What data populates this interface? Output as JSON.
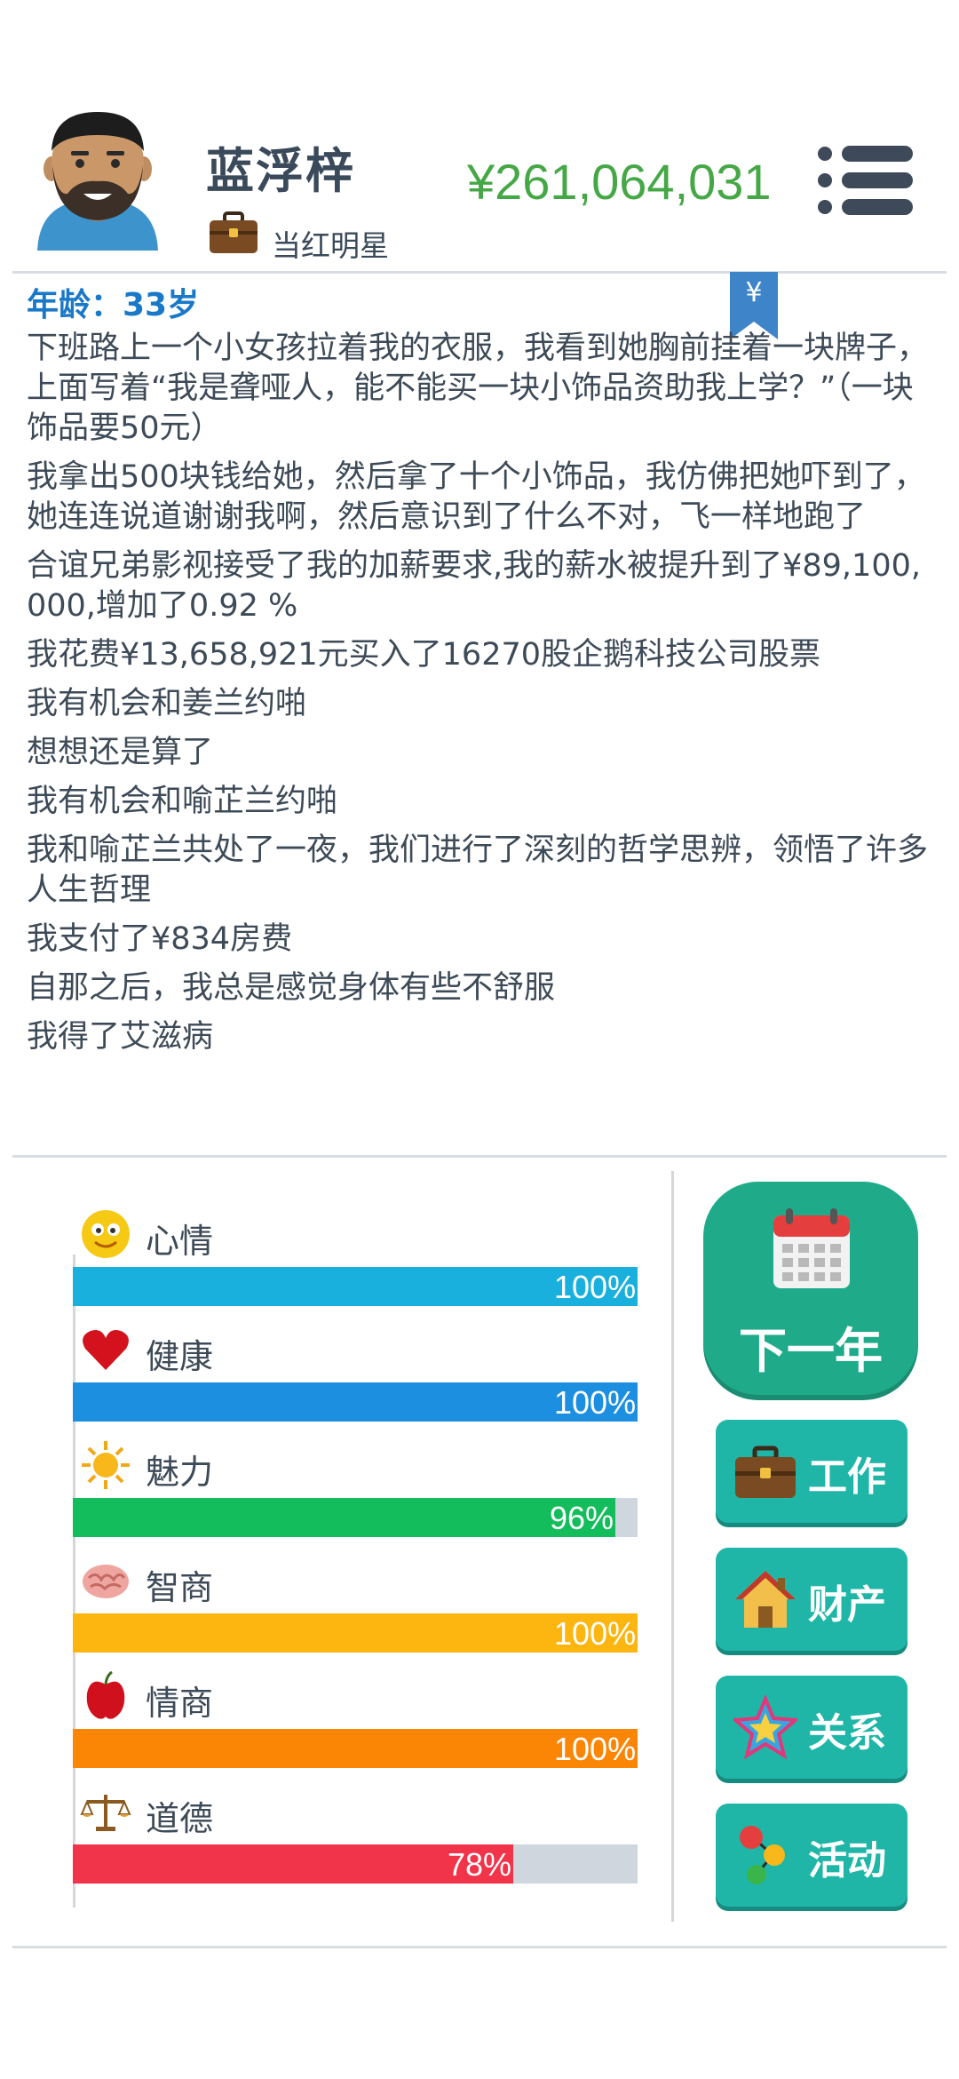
{
  "header": {
    "name": "蓝浮梓",
    "job": "当红明星",
    "money": "¥261,064,031",
    "icons": {
      "avatar": "bearded-man-avatar",
      "job": "briefcase-icon",
      "menu": "menu-icon"
    }
  },
  "age_label": "年龄：33岁",
  "bookmark_label": "¥",
  "log": [
    "下班路上一个小女孩拉着我的衣服，我看到她胸前挂着一块牌子，上面写着“我是聋哑人，能不能买一块小饰品资助我上学？”（一块饰品要50元）",
    "我拿出500块钱给她，然后拿了十个小饰品，我仿佛把她吓到了，她连连说道谢谢我啊，然后意识到了什么不对，飞一样地跑了",
    "合谊兄弟影视接受了我的加薪要求,我的薪水被提升到了¥89,100,000,增加了0.92 %",
    "我花费¥13,658,921元买入了16270股企鹅科技公司股票",
    "我有机会和姜兰约啪",
    "想想还是算了",
    "我有机会和喻芷兰约啪",
    "我和喻芷兰共处了一夜，我们进行了深刻的哲学思辨，领悟了许多人生哲理",
    "我支付了¥834房费",
    "自那之后，我总是感觉身体有些不舒服",
    "我得了艾滋病"
  ],
  "stats": [
    {
      "label": "心情",
      "value": 100,
      "text": "100%",
      "color": "#1ab0dd",
      "icon": "smiley-icon"
    },
    {
      "label": "健康",
      "value": 100,
      "text": "100%",
      "color": "#1d8fe0",
      "icon": "heart-icon"
    },
    {
      "label": "魅力",
      "value": 96,
      "text": "96%",
      "color": "#14bd5c",
      "icon": "sun-icon"
    },
    {
      "label": "智商",
      "value": 100,
      "text": "100%",
      "color": "#fdb510",
      "icon": "brain-icon"
    },
    {
      "label": "情商",
      "value": 100,
      "text": "100%",
      "color": "#fb8505",
      "icon": "apple-icon"
    },
    {
      "label": "道德",
      "value": 78,
      "text": "78%",
      "color": "#f2344a",
      "icon": "scales-icon"
    }
  ],
  "actions": {
    "next_year": "下一年",
    "work": "工作",
    "property": "财产",
    "relations": "关系",
    "activities": "活动"
  }
}
